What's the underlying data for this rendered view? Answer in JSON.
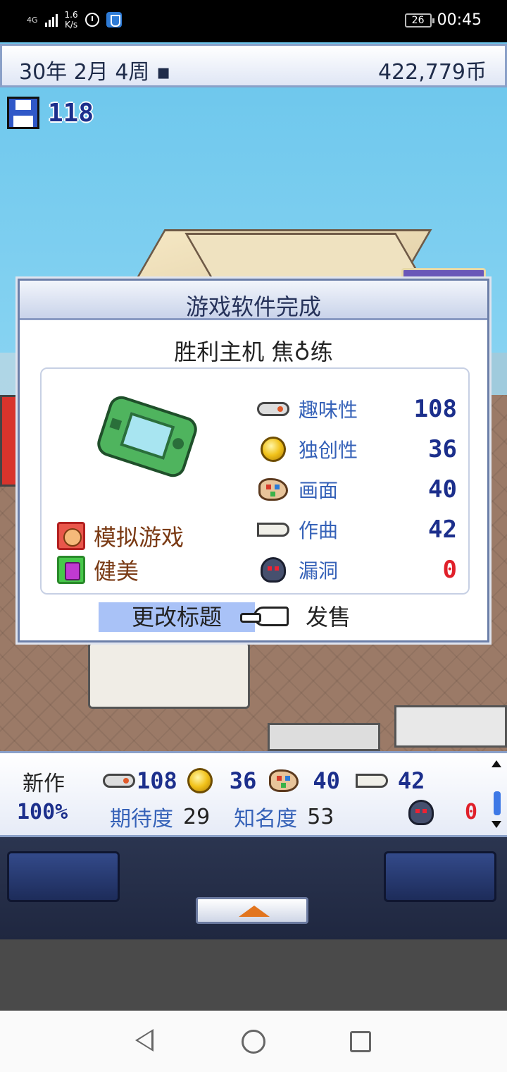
{
  "status_bar": {
    "network": "4G",
    "speed": "1.6\nK/s",
    "battery": "26",
    "time": "00:45"
  },
  "top_bar": {
    "date": "30年 2月 4周 ▪",
    "money": "422,779币"
  },
  "floppy": {
    "count": "118"
  },
  "dialog": {
    "title": "游戏软件完成",
    "game_name": "胜利主机 焦♁练",
    "genres": [
      {
        "label": "模拟游戏",
        "icon": "face-icon"
      },
      {
        "label": "健美",
        "icon": "gem-icon"
      }
    ],
    "stats": [
      {
        "label": "趣味性",
        "value": "108",
        "icon": "gamepad-icon"
      },
      {
        "label": "独创性",
        "value": "36",
        "icon": "coin-icon"
      },
      {
        "label": "画面",
        "value": "40",
        "icon": "palette-icon"
      },
      {
        "label": "作曲",
        "value": "42",
        "icon": "trumpet-icon"
      },
      {
        "label": "漏洞",
        "value": "0",
        "icon": "bug-icon"
      }
    ],
    "rename_button": "更改标题",
    "sell_button": "发售"
  },
  "bottom_panel": {
    "new_label": "新作",
    "progress": "100%",
    "fun": "108",
    "creativity": "36",
    "graphics": "40",
    "sound": "42",
    "expectation_label": "期待度",
    "expectation_value": "29",
    "fame_label": "知名度",
    "fame_value": "53",
    "bugs": "0"
  },
  "colors": {
    "accent_blue": "#1c2f8c",
    "label_blue": "#3662b8",
    "bug_red": "#e0202a",
    "genre_brown": "#7a3a14"
  }
}
